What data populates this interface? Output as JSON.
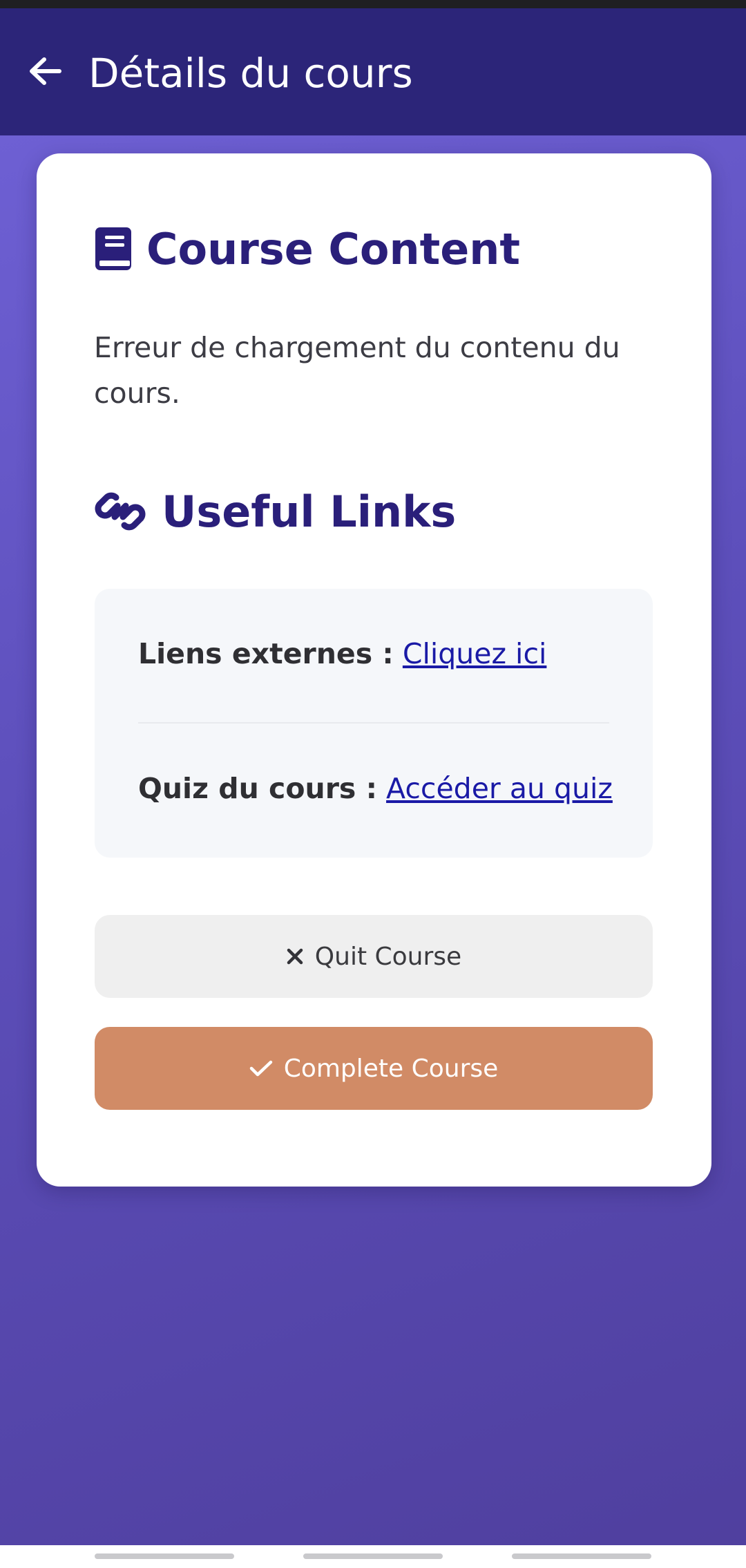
{
  "app_bar": {
    "title": "Détails du cours",
    "back_icon": "arrow-left-icon"
  },
  "course_content": {
    "heading": "Course Content",
    "icon": "book-icon",
    "error_message": "Erreur de chargement du contenu du cours."
  },
  "useful_links": {
    "heading": "Useful Links",
    "icon": "link-icon",
    "items": [
      {
        "label": "Liens externes :",
        "link_text": "Cliquez ici"
      },
      {
        "label": "Quiz du cours :",
        "link_text": "Accéder au quiz"
      }
    ]
  },
  "actions": {
    "quit_label": "Quit Course",
    "quit_icon": "close-icon",
    "complete_label": "Complete Course",
    "complete_icon": "checkmark-icon"
  },
  "colors": {
    "app_bar": "#2c2579",
    "heading": "#2a1f7a",
    "link": "#1a1aa6",
    "complete_button": "#d18b66",
    "quit_button": "#efefef"
  }
}
